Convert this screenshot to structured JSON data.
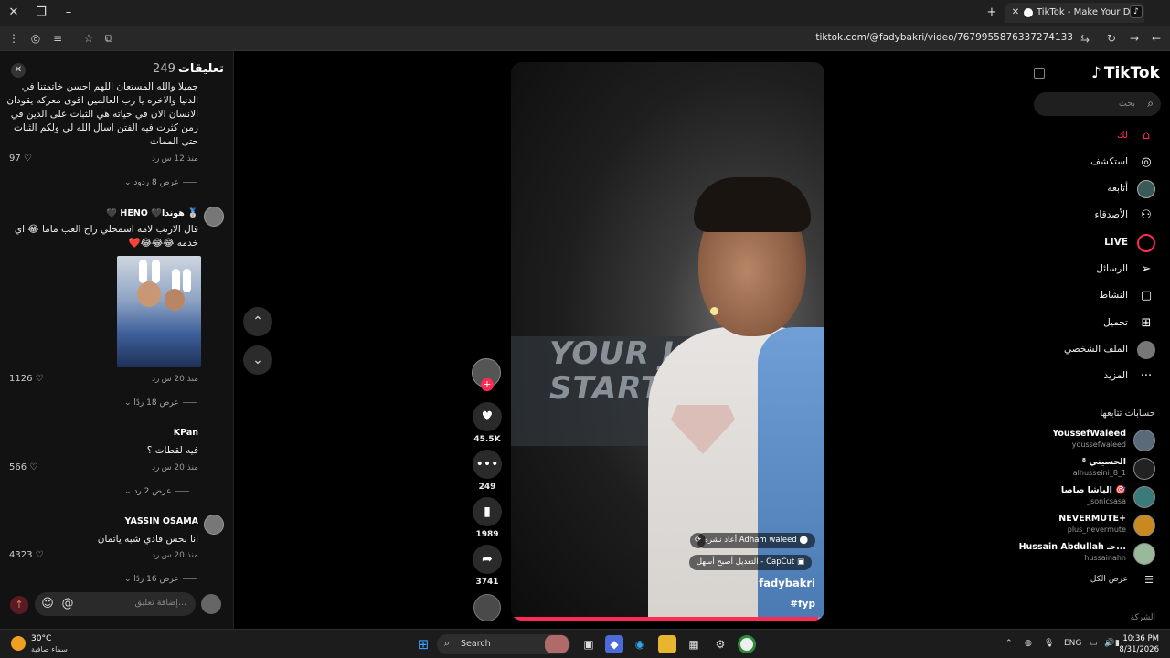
{
  "browser": {
    "tab_title": "TikTok - Make Your Day",
    "url": "tiktok.com/@fadybakri/video/7679955876337274133"
  },
  "comments_panel": {
    "title": "تعليقات",
    "count": "249",
    "input_placeholder": "إضافة تعليق...",
    "items": [
      {
        "text": "جميلا والله المستعان اللهم احسن خاتمتنا في الدنيا والاخره يا رب العالمين اقوى معركه يقودان الانسان الان في حياته هي الثبات على الدين في زمن كثرت فيه الفتن اسال الله لي ولكم الثبات حتى الممات",
        "time": "منذ 12 س",
        "reply": "رد",
        "likes": "97",
        "replies": "عرض 8 ردود"
      },
      {
        "user": "🥈 هوندا🖤 HENO 🖤",
        "text": "قال الارنب لامه اسمحلي راح العب ماما 😂 اي خدمه 😂😂😂❤️",
        "time": "منذ 20 س",
        "reply": "رد",
        "likes": "1126",
        "replies": "عرض 18 ردًا"
      },
      {
        "user": "KPan",
        "text": "فيه لقطات ؟",
        "time": "منذ 20 س",
        "reply": "رد",
        "likes": "566",
        "replies": "عرض 2 رد"
      },
      {
        "user": "YASSIN OSAMA",
        "text": "انا بحس فادي شبه ياتمان",
        "time": "منذ 20 س",
        "reply": "رد",
        "likes": "4323",
        "replies": "عرض 16 ردًا"
      }
    ]
  },
  "video": {
    "wall_text": "YOUR JOURN\nSTARTS",
    "repost_pill": "Adham waleed أعاد نشره",
    "capcut_pill": "CapCut - التعديل أصبح أسهل",
    "author": "fadybakri",
    "tag": "#fyp",
    "progress": 0.98
  },
  "actions": {
    "likes": "45.5K",
    "comments": "249",
    "saves": "1989",
    "shares": "3741"
  },
  "sidebar": {
    "logo": "TikTok",
    "search_placeholder": "بحث",
    "nav": [
      {
        "label": "لك",
        "icon": "home-icon",
        "active": true
      },
      {
        "label": "استكشف",
        "icon": "compass-icon"
      },
      {
        "label": "أتابعه",
        "icon": "following-icon"
      },
      {
        "label": "الأصدقاء",
        "icon": "friends-icon"
      },
      {
        "label": "LIVE",
        "icon": "live-icon"
      },
      {
        "label": "الرسائل",
        "icon": "messages-icon"
      },
      {
        "label": "النشاط",
        "icon": "activity-icon"
      },
      {
        "label": "تحميل",
        "icon": "upload-icon"
      },
      {
        "label": "الملف الشخصي",
        "icon": "profile-icon"
      },
      {
        "label": "المزيد",
        "icon": "more-icon"
      }
    ],
    "following_title": "حسابات تتابعها",
    "accounts": [
      {
        "name": "YoussefWaleed",
        "handle": "youssefwaleed"
      },
      {
        "name": "الحسيني ⁸",
        "handle": "alhusseini_8_1"
      },
      {
        "name": "الباشا صاصا 🎯",
        "handle": "_sonicsasa"
      },
      {
        "name": "NEVERMUTE+",
        "handle": "plus_nevermute"
      },
      {
        "name": "Hussain Abdullah حـ...",
        "handle": "hussainahn"
      }
    ],
    "see_all": "عرض الكل",
    "company": "الشركة"
  },
  "taskbar": {
    "temp": "30°C",
    "weather": "سماء صافية",
    "search": "Search",
    "lang": "ENG",
    "time": "10:36 PM",
    "date": "8/31/2026"
  }
}
